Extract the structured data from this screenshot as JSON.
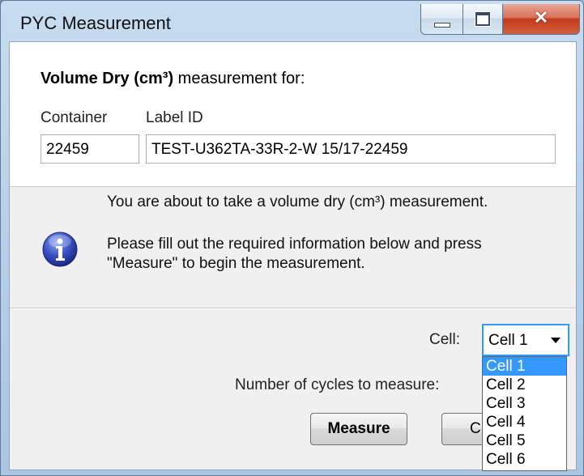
{
  "window": {
    "title": "PYC Measurement"
  },
  "heading": {
    "bold": "Volume Dry (cm³)",
    "rest": " measurement for:"
  },
  "fields": {
    "container_label": "Container",
    "label_id_label": "Label ID",
    "container_value": "22459",
    "label_id_value": "TEST-U362TA-33R-2-W 15/17-22459"
  },
  "info": {
    "icon": "info-icon",
    "line1": "You are about to take a volume dry (cm³) measurement.",
    "line2": "Please fill out the required information below and press",
    "line3": "\"Measure\" to begin the measurement."
  },
  "cell": {
    "label": "Cell:",
    "selected": "Cell 1",
    "options": [
      "Cell 1",
      "Cell 2",
      "Cell 3",
      "Cell 4",
      "Cell 5",
      "Cell 6"
    ]
  },
  "cycles": {
    "label": "Number of cycles to measure:"
  },
  "buttons": {
    "measure": "Measure",
    "cancel_partial": "C"
  }
}
